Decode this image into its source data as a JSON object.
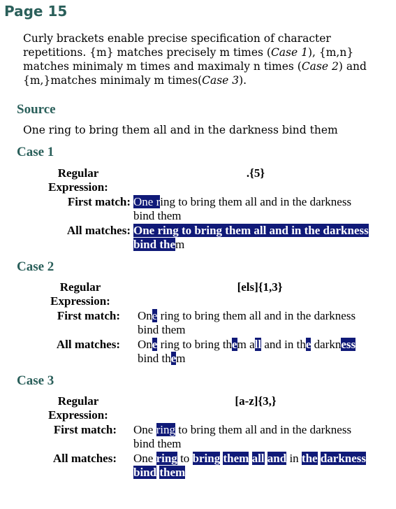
{
  "page_title": "Page 15",
  "intro": {
    "t1": "Curly brackets enable precise specification of character repetitions. {m} matches precisely m times (",
    "c1": "Case 1",
    "t2": "), {m,n} matches minimaly m times and maximaly n times (",
    "c2": "Case 2",
    "t3": ") and {m,}matches minimaly m times(",
    "c3": "Case 3",
    "t4": ")."
  },
  "source": {
    "heading": "Source",
    "text": "One ring to bring them all and in the darkness bind them"
  },
  "labels": {
    "regex_line1": "Regular",
    "regex_line2": "Expression:",
    "first_match": "First match:",
    "all_matches": "All matches:"
  },
  "cases": [
    {
      "heading": "Case 1",
      "regex": ".{5}",
      "first_match": [
        {
          "t": "One r",
          "h": true
        },
        {
          "t": "ing to bring them all and in the darkness bind them",
          "h": false
        }
      ],
      "all_matches": [
        {
          "t": "One ring to bring them all and in the darkness bind the",
          "h": true
        },
        {
          "t": "m",
          "h": false
        }
      ]
    },
    {
      "heading": "Case 2",
      "regex": "[els]{1,3}",
      "first_match": [
        {
          "t": "On",
          "h": false
        },
        {
          "t": "e",
          "h": true
        },
        {
          "t": " ring to bring them all and in the darkness bind them",
          "h": false
        }
      ],
      "all_matches": [
        {
          "t": "On",
          "h": false
        },
        {
          "t": "e",
          "h": true
        },
        {
          "t": " ring to bring th",
          "h": false
        },
        {
          "t": "e",
          "h": true
        },
        {
          "t": "m a",
          "h": false
        },
        {
          "t": "ll",
          "h": true
        },
        {
          "t": " and in th",
          "h": false
        },
        {
          "t": "e",
          "h": true
        },
        {
          "t": " darkn",
          "h": false
        },
        {
          "t": "ess",
          "h": true
        },
        {
          "t": " bind th",
          "h": false
        },
        {
          "t": "e",
          "h": true
        },
        {
          "t": "m",
          "h": false
        }
      ]
    },
    {
      "heading": "Case 3",
      "regex": "[a-z]{3,}",
      "first_match": [
        {
          "t": "One ",
          "h": false
        },
        {
          "t": "ring",
          "h": true
        },
        {
          "t": " to bring them all and in the darkness bind them",
          "h": false
        }
      ],
      "all_matches": [
        {
          "t": "One ",
          "h": false
        },
        {
          "t": "ring",
          "h": true
        },
        {
          "t": " to ",
          "h": false
        },
        {
          "t": "bring",
          "h": true
        },
        {
          "t": " ",
          "h": false
        },
        {
          "t": "them",
          "h": true
        },
        {
          "t": " ",
          "h": false
        },
        {
          "t": "all",
          "h": true
        },
        {
          "t": " ",
          "h": false
        },
        {
          "t": "and",
          "h": true
        },
        {
          "t": " in ",
          "h": false
        },
        {
          "t": "the",
          "h": true
        },
        {
          "t": " ",
          "h": false
        },
        {
          "t": "darkness",
          "h": true
        },
        {
          "t": " ",
          "h": false
        },
        {
          "t": "bind",
          "h": true
        },
        {
          "t": " ",
          "h": false
        },
        {
          "t": "them",
          "h": true
        }
      ]
    }
  ]
}
